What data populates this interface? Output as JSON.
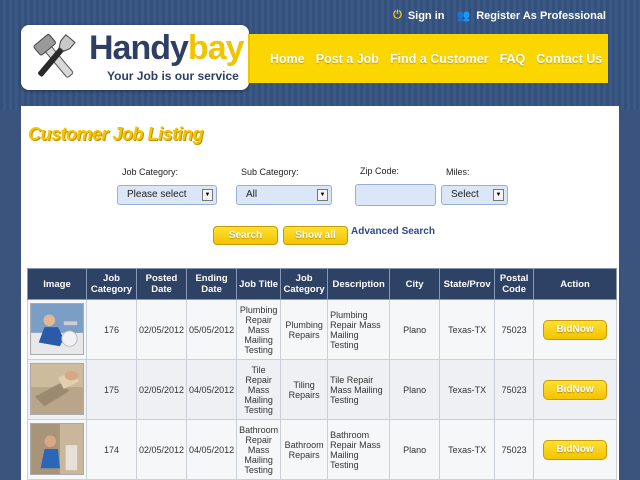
{
  "header": {
    "sign_in": "Sign in",
    "register": "Register As Professional",
    "logo_main": "Handy",
    "logo_accent": "bay",
    "tagline": "Your Job is our service"
  },
  "nav": [
    "Home",
    "Post a Job",
    "Find a Customer",
    "FAQ",
    "Contact Us"
  ],
  "page": {
    "title": "Customer Job Listing"
  },
  "filters": {
    "job_category_label": "Job Category:",
    "job_category_value": "Please select",
    "sub_category_label": "Sub Category:",
    "sub_category_value": "All",
    "zip_label": "Zip Code:",
    "zip_value": "",
    "miles_label": "Miles:",
    "miles_value": "Select",
    "search_button": "Search",
    "show_all_button": "Show all",
    "advanced_search": "Advanced Search"
  },
  "table": {
    "headers": [
      "Image",
      "Job Category",
      "Posted Date",
      "Ending Date",
      "Job Title",
      "Job Category",
      "Description",
      "City",
      "State/Prov",
      "Postal Code",
      "Action"
    ],
    "rows": [
      {
        "id": "176",
        "posted": "02/05/2012",
        "ending": "05/05/2012",
        "title": "Plumbing Repair Mass Mailing Testing",
        "category": "Plumbing Repairs",
        "description": "Plumbing Repair Mass Mailing Testing",
        "city": "Plano",
        "state": "Texas-TX",
        "postal": "75023",
        "action": "BidNow"
      },
      {
        "id": "175",
        "posted": "02/05/2012",
        "ending": "04/05/2012",
        "title": "Tile Repair Mass Mailing Testing",
        "category": "Tiling Repairs",
        "description": "Tile Repair Mass Mailing Testing",
        "city": "Plano",
        "state": "Texas-TX",
        "postal": "75023",
        "action": "BidNow"
      },
      {
        "id": "174",
        "posted": "02/05/2012",
        "ending": "04/05/2012",
        "title": "Bathroom Repair Mass Mailing Testing",
        "category": "Bathroom Repairs",
        "description": "Bathroom Repair Mass Mailing Testing",
        "city": "Plano",
        "state": "Texas-TX",
        "postal": "75023",
        "action": "BidNow"
      }
    ]
  },
  "colors": {
    "brand_blue": "#2e3f63",
    "brand_yellow": "#fcd600",
    "header_bg": "#3a547e"
  }
}
